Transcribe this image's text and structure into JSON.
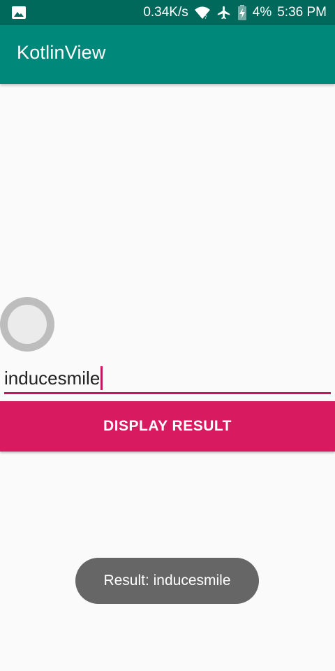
{
  "status_bar": {
    "left_icons": [
      "image-icon"
    ],
    "network_speed": "0.34K/s",
    "icons": [
      "wifi-icon",
      "airplane-icon",
      "battery-charging-icon"
    ],
    "battery": "4%",
    "time": "5:36 PM"
  },
  "app_bar": {
    "title": "KotlinView",
    "color": "#00897b"
  },
  "radio": {
    "checked": false
  },
  "input": {
    "value": "inducesmile",
    "accent_color": "#c2185b"
  },
  "button": {
    "label": "DISPLAY RESULT",
    "color": "#d81b60"
  },
  "toast": {
    "text": "Result: inducesmile"
  }
}
